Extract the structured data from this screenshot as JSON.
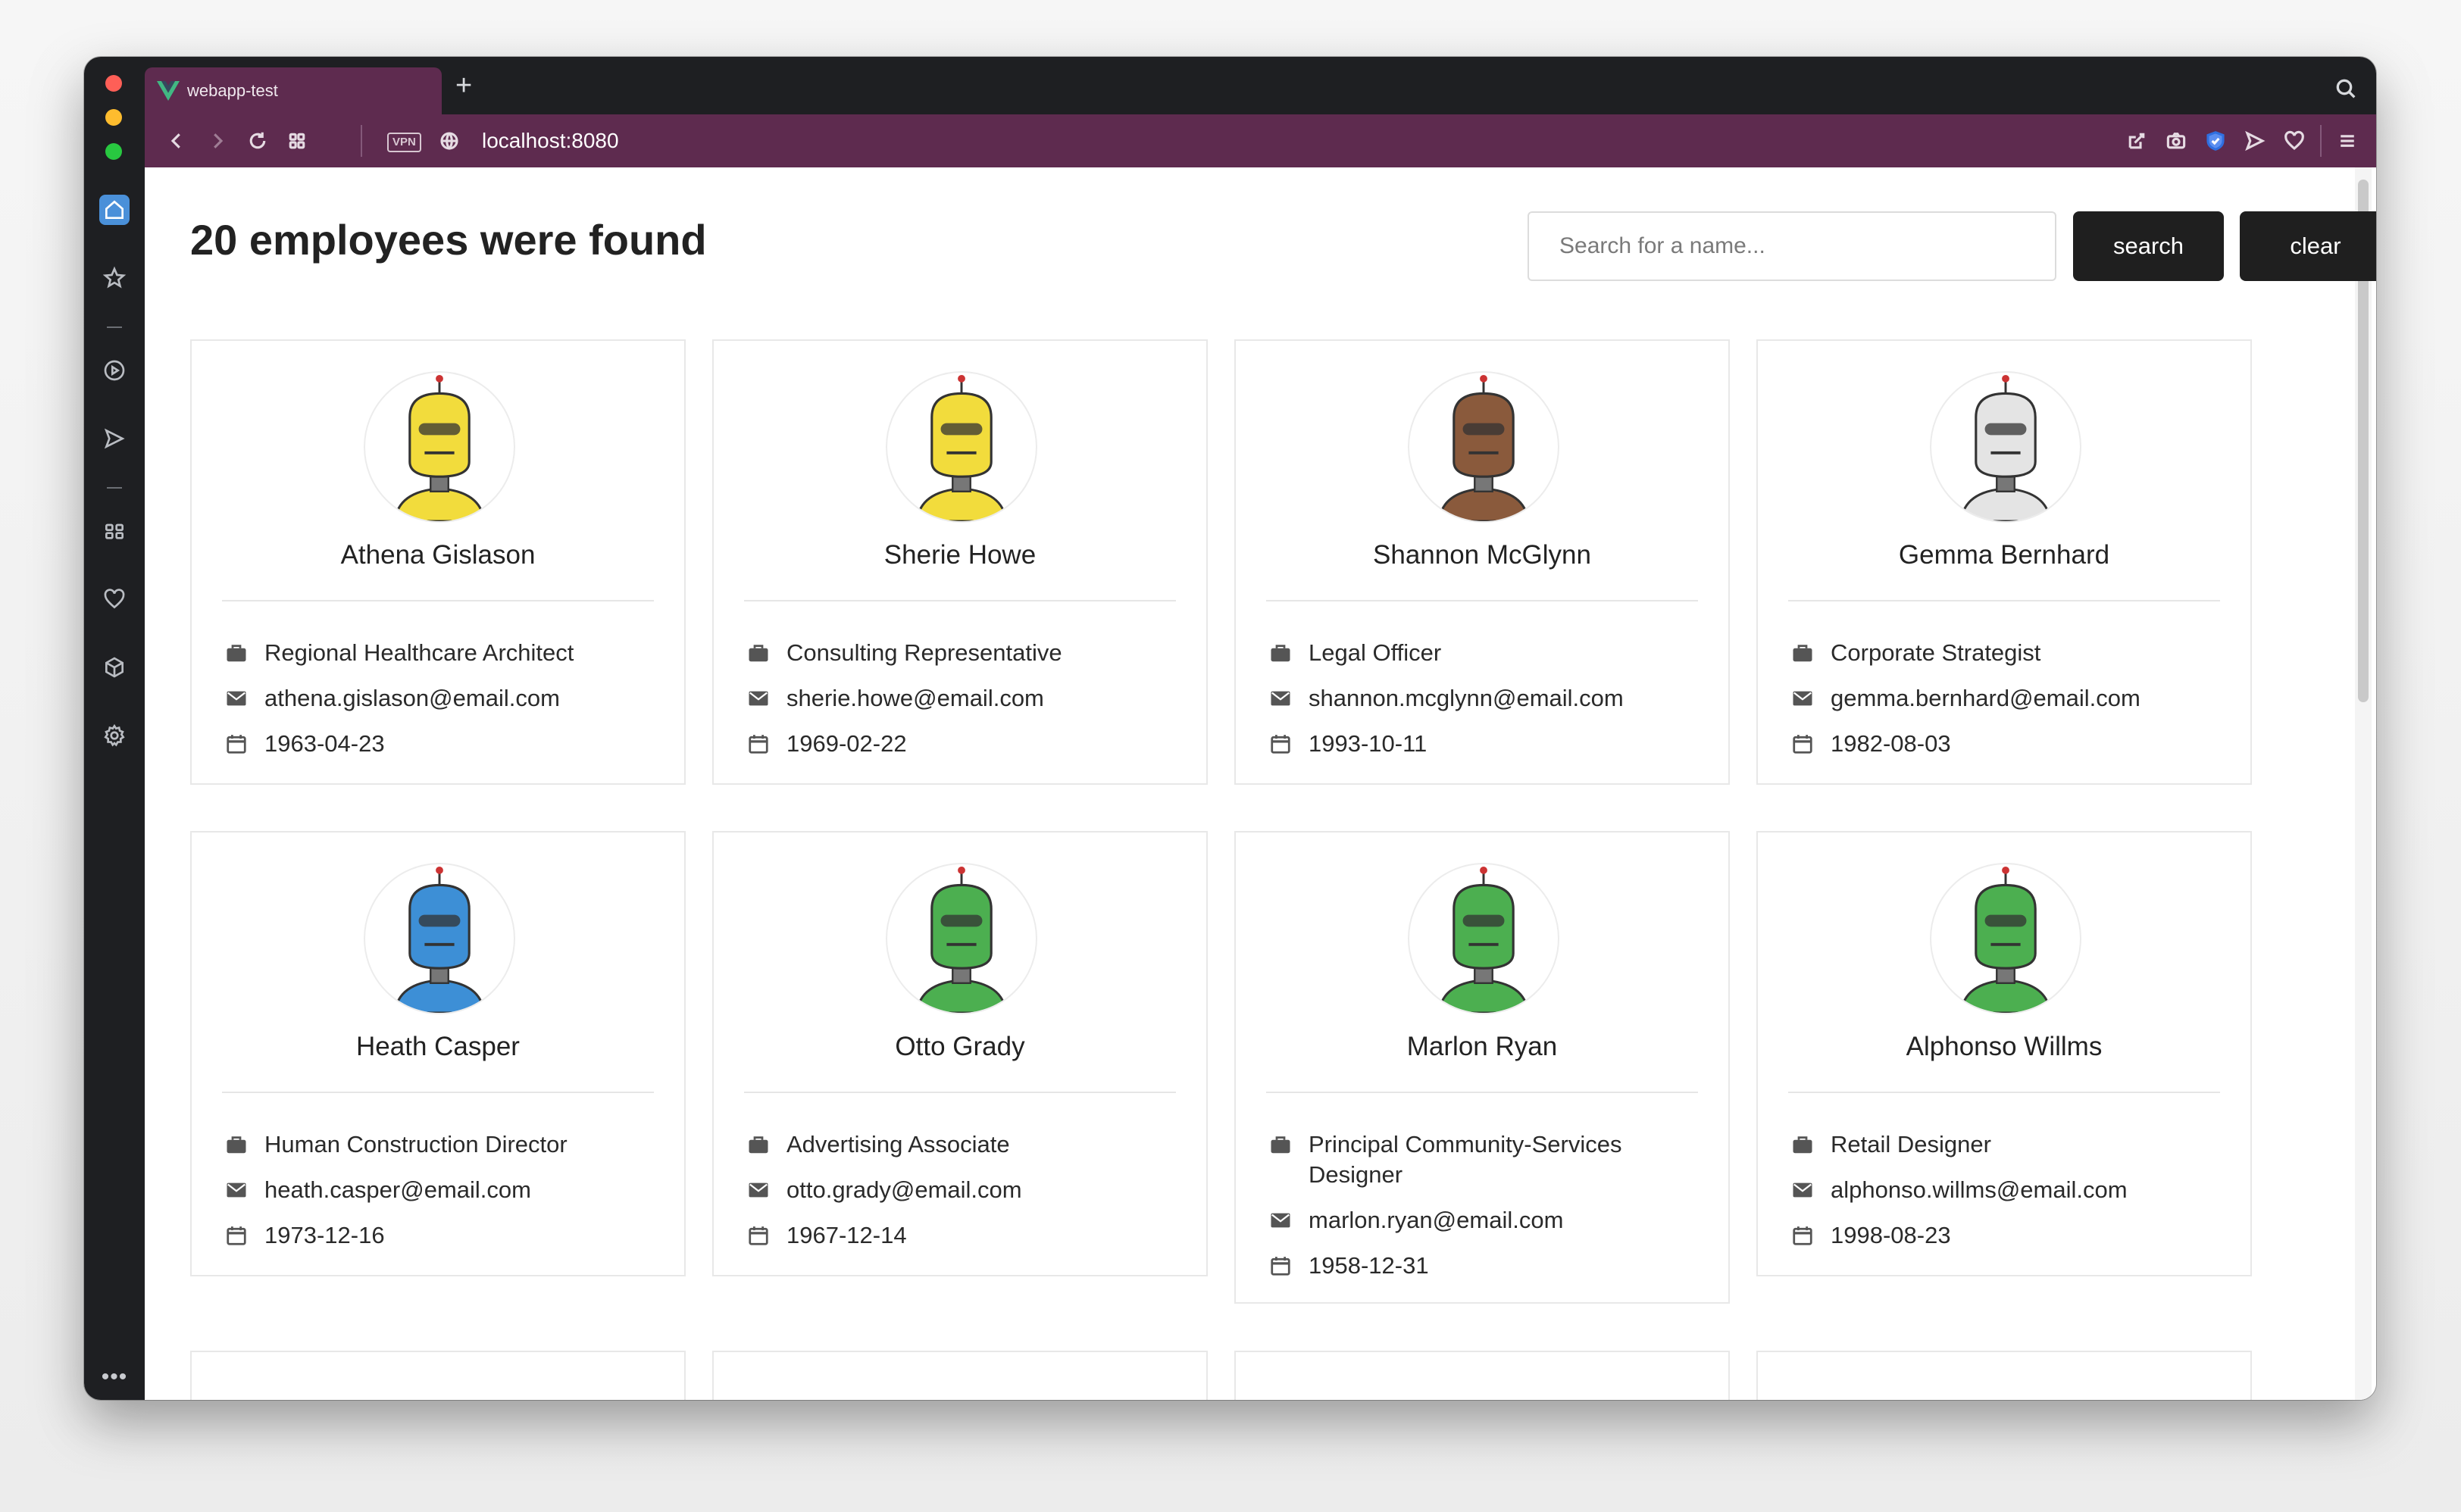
{
  "browser": {
    "tab_title": "webapp-test",
    "new_tab_label": "+",
    "url": "localhost:8080",
    "vpn_label": "VPN",
    "more_label": "•••"
  },
  "page": {
    "title": "20 employees were found",
    "search_placeholder": "Search for a name...",
    "search_value": "",
    "search_button": "search",
    "clear_button": "clear"
  },
  "employees": [
    {
      "name": "Athena Gislason",
      "title": "Regional Healthcare Architect",
      "email": "athena.gislason@email.com",
      "dob": "1963-04-23",
      "robot_color": "#f2dc3c"
    },
    {
      "name": "Sherie Howe",
      "title": "Consulting Representative",
      "email": "sherie.howe@email.com",
      "dob": "1969-02-22",
      "robot_color": "#f2dc3c"
    },
    {
      "name": "Shannon McGlynn",
      "title": "Legal Officer",
      "email": "shannon.mcglynn@email.com",
      "dob": "1993-10-11",
      "robot_color": "#8a5a3c"
    },
    {
      "name": "Gemma Bernhard",
      "title": "Corporate Strategist",
      "email": "gemma.bernhard@email.com",
      "dob": "1982-08-03",
      "robot_color": "#e4e4e4"
    },
    {
      "name": "Heath Casper",
      "title": "Human Construction Director",
      "email": "heath.casper@email.com",
      "dob": "1973-12-16",
      "robot_color": "#3d8fd6"
    },
    {
      "name": "Otto Grady",
      "title": "Advertising Associate",
      "email": "otto.grady@email.com",
      "dob": "1967-12-14",
      "robot_color": "#4caf50"
    },
    {
      "name": "Marlon Ryan",
      "title": "Principal Community-Services Designer",
      "email": "marlon.ryan@email.com",
      "dob": "1958-12-31",
      "robot_color": "#4caf50"
    },
    {
      "name": "Alphonso Willms",
      "title": "Retail Designer",
      "email": "alphonso.willms@email.com",
      "dob": "1998-08-23",
      "robot_color": "#4caf50"
    }
  ],
  "colors": {
    "accent": "#5e2b4f",
    "sidebar": "#1e1f22",
    "button": "#1f1f1f"
  }
}
